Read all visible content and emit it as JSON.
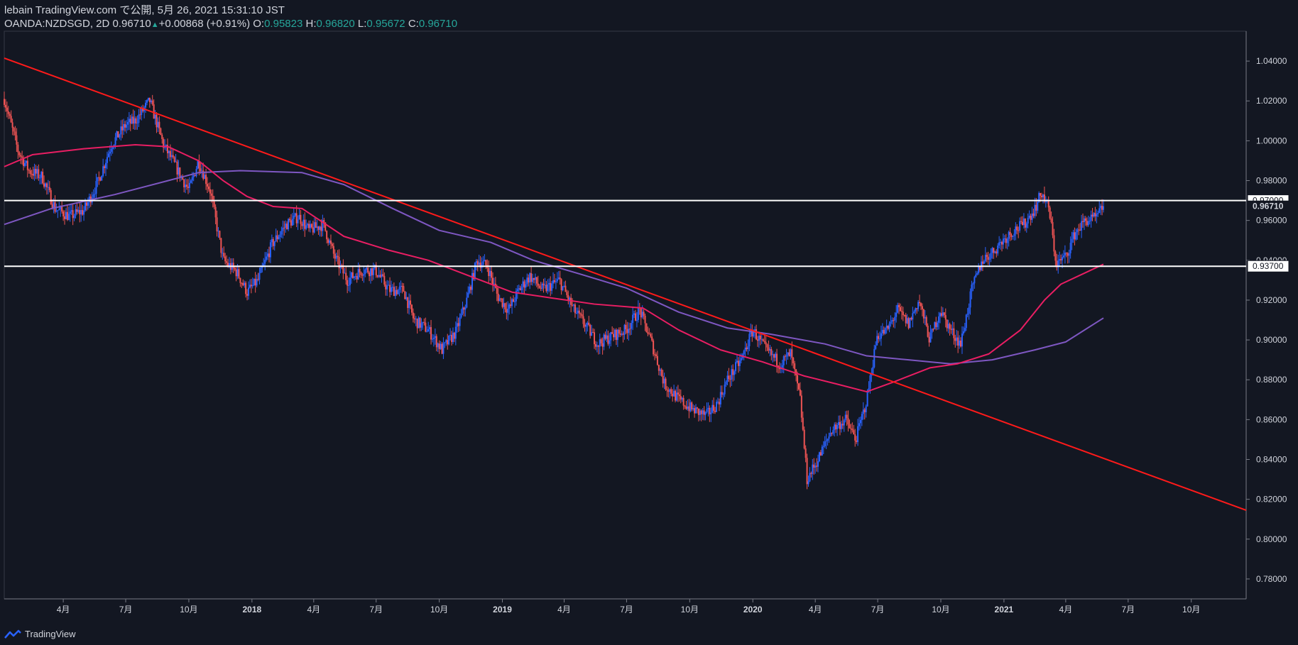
{
  "header": {
    "line1": "lebain TradingView.com で公開, 5月 26, 2021 15:31:10 JST",
    "symbol": "OANDA:NZDSGD, 2D 0.96710",
    "change": "+0.00868 (+0.91%)",
    "o_label": "O:",
    "o": "0.95823",
    "h_label": "H:",
    "h": "0.96820",
    "l_label": "L:",
    "l": "0.95672",
    "c_label": "C:",
    "c": "0.96710"
  },
  "footer": {
    "brand": "TradingView"
  },
  "colors": {
    "background": "#131722",
    "up": "#2962ff",
    "down": "#f05454",
    "ma_fast": "#e91e63",
    "ma_slow": "#7e57c2",
    "trendline": "#ff1a1a",
    "level_line": "#ffffff"
  },
  "chart_data": {
    "type": "candlestick",
    "symbol": "OANDA:NZDSGD",
    "interval": "2D",
    "ylim": [
      0.77,
      1.055
    ],
    "y_ticks": [
      "1.04000",
      "1.02000",
      "1.00000",
      "0.98000",
      "0.96000",
      "0.94000",
      "0.92000",
      "0.90000",
      "0.88000",
      "0.86000",
      "0.84000",
      "0.82000",
      "0.80000",
      "0.78000"
    ],
    "x_ticks": [
      "4月",
      "7月",
      "10月",
      "2018",
      "4月",
      "7月",
      "10月",
      "2019",
      "4月",
      "7月",
      "10月",
      "2020",
      "4月",
      "7月",
      "10月",
      "2021",
      "4月",
      "7月",
      "10月"
    ],
    "x_tick_dates": [
      "2017-04-01",
      "2017-07-01",
      "2017-10-01",
      "2018-01-01",
      "2018-04-01",
      "2018-07-01",
      "2018-10-01",
      "2019-01-01",
      "2019-04-01",
      "2019-07-01",
      "2019-10-01",
      "2020-01-01",
      "2020-04-01",
      "2020-07-01",
      "2020-10-01",
      "2021-01-01",
      "2021-04-01",
      "2021-07-01",
      "2021-10-01"
    ],
    "xlim": [
      "2017-01-05",
      "2021-12-20"
    ],
    "horizontal_levels": [
      {
        "value": 0.97,
        "label": "0.97000"
      },
      {
        "value": 0.937,
        "label": "0.93700"
      }
    ],
    "last_price_label": "0.96710",
    "trendline": {
      "start": [
        "2017-01-05",
        1.0415
      ],
      "end": [
        "2021-12-20",
        0.8145
      ]
    },
    "price_path": [
      [
        "2017-01-05",
        1.021
      ],
      [
        "2017-01-25",
        0.995
      ],
      [
        "2017-02-10",
        0.985
      ],
      [
        "2017-03-01",
        0.982
      ],
      [
        "2017-03-20",
        0.966
      ],
      [
        "2017-04-10",
        0.962
      ],
      [
        "2017-05-01",
        0.965
      ],
      [
        "2017-05-20",
        0.978
      ],
      [
        "2017-06-10",
        0.998
      ],
      [
        "2017-07-01",
        1.008
      ],
      [
        "2017-07-15",
        1.01
      ],
      [
        "2017-08-05",
        1.02
      ],
      [
        "2017-08-25",
        0.998
      ],
      [
        "2017-09-15",
        0.985
      ],
      [
        "2017-10-01",
        0.975
      ],
      [
        "2017-10-15",
        0.99
      ],
      [
        "2017-11-01",
        0.975
      ],
      [
        "2017-11-20",
        0.94
      ],
      [
        "2017-12-10",
        0.934
      ],
      [
        "2017-12-25",
        0.924
      ],
      [
        "2018-01-10",
        0.93
      ],
      [
        "2018-01-30",
        0.948
      ],
      [
        "2018-02-20",
        0.958
      ],
      [
        "2018-03-10",
        0.962
      ],
      [
        "2018-03-25",
        0.955
      ],
      [
        "2018-04-15",
        0.958
      ],
      [
        "2018-05-01",
        0.942
      ],
      [
        "2018-05-20",
        0.93
      ],
      [
        "2018-06-10",
        0.935
      ],
      [
        "2018-06-30",
        0.935
      ],
      [
        "2018-07-20",
        0.925
      ],
      [
        "2018-08-10",
        0.925
      ],
      [
        "2018-08-25",
        0.91
      ],
      [
        "2018-09-15",
        0.905
      ],
      [
        "2018-10-05",
        0.895
      ],
      [
        "2018-10-25",
        0.904
      ],
      [
        "2018-11-10",
        0.92
      ],
      [
        "2018-11-25",
        0.94
      ],
      [
        "2018-12-10",
        0.937
      ],
      [
        "2018-12-25",
        0.922
      ],
      [
        "2019-01-10",
        0.915
      ],
      [
        "2019-01-25",
        0.925
      ],
      [
        "2019-02-10",
        0.932
      ],
      [
        "2019-03-01",
        0.925
      ],
      [
        "2019-03-25",
        0.93
      ],
      [
        "2019-04-15",
        0.915
      ],
      [
        "2019-05-01",
        0.908
      ],
      [
        "2019-05-20",
        0.898
      ],
      [
        "2019-06-10",
        0.902
      ],
      [
        "2019-06-30",
        0.905
      ],
      [
        "2019-07-20",
        0.915
      ],
      [
        "2019-08-05",
        0.9
      ],
      [
        "2019-08-25",
        0.878
      ],
      [
        "2019-09-15",
        0.87
      ],
      [
        "2019-10-05",
        0.865
      ],
      [
        "2019-10-25",
        0.862
      ],
      [
        "2019-11-10",
        0.868
      ],
      [
        "2019-11-25",
        0.88
      ],
      [
        "2019-12-15",
        0.89
      ],
      [
        "2020-01-01",
        0.905
      ],
      [
        "2020-01-20",
        0.895
      ],
      [
        "2020-02-10",
        0.888
      ],
      [
        "2020-02-25",
        0.893
      ],
      [
        "2020-03-10",
        0.87
      ],
      [
        "2020-03-20",
        0.83
      ],
      [
        "2020-04-05",
        0.84
      ],
      [
        "2020-04-25",
        0.855
      ],
      [
        "2020-05-15",
        0.86
      ],
      [
        "2020-05-30",
        0.85
      ],
      [
        "2020-06-15",
        0.87
      ],
      [
        "2020-06-30",
        0.902
      ],
      [
        "2020-07-15",
        0.905
      ],
      [
        "2020-07-30",
        0.915
      ],
      [
        "2020-08-15",
        0.908
      ],
      [
        "2020-08-30",
        0.92
      ],
      [
        "2020-09-15",
        0.9
      ],
      [
        "2020-09-30",
        0.915
      ],
      [
        "2020-10-15",
        0.905
      ],
      [
        "2020-10-30",
        0.898
      ],
      [
        "2020-11-15",
        0.925
      ],
      [
        "2020-11-30",
        0.94
      ],
      [
        "2020-12-15",
        0.944
      ],
      [
        "2020-12-30",
        0.95
      ],
      [
        "2021-01-15",
        0.955
      ],
      [
        "2021-01-30",
        0.958
      ],
      [
        "2021-02-15",
        0.966
      ],
      [
        "2021-02-25",
        0.974
      ],
      [
        "2021-03-08",
        0.965
      ],
      [
        "2021-03-18",
        0.938
      ],
      [
        "2021-04-01",
        0.942
      ],
      [
        "2021-04-15",
        0.954
      ],
      [
        "2021-04-30",
        0.96
      ],
      [
        "2021-05-15",
        0.961
      ],
      [
        "2021-05-26",
        0.9671
      ]
    ],
    "ma_fast_path": [
      [
        "2017-01-05",
        0.987
      ],
      [
        "2017-02-15",
        0.993
      ],
      [
        "2017-05-01",
        0.996
      ],
      [
        "2017-07-15",
        0.998
      ],
      [
        "2017-09-01",
        0.997
      ],
      [
        "2017-10-15",
        0.99
      ],
      [
        "2017-11-20",
        0.98
      ],
      [
        "2017-12-25",
        0.972
      ],
      [
        "2018-02-01",
        0.967
      ],
      [
        "2018-03-15",
        0.966
      ],
      [
        "2018-05-15",
        0.952
      ],
      [
        "2018-07-20",
        0.945
      ],
      [
        "2018-09-15",
        0.94
      ],
      [
        "2018-11-15",
        0.932
      ],
      [
        "2019-01-15",
        0.924
      ],
      [
        "2019-03-15",
        0.921
      ],
      [
        "2019-05-15",
        0.918
      ],
      [
        "2019-07-25",
        0.916
      ],
      [
        "2019-09-15",
        0.905
      ],
      [
        "2019-11-15",
        0.895
      ],
      [
        "2020-01-15",
        0.889
      ],
      [
        "2020-03-15",
        0.882
      ],
      [
        "2020-05-01",
        0.878
      ],
      [
        "2020-06-15",
        0.874
      ],
      [
        "2020-07-25",
        0.879
      ],
      [
        "2020-09-15",
        0.886
      ],
      [
        "2020-10-25",
        0.888
      ],
      [
        "2020-12-10",
        0.893
      ],
      [
        "2021-01-25",
        0.905
      ],
      [
        "2021-03-01",
        0.92
      ],
      [
        "2021-03-25",
        0.928
      ],
      [
        "2021-05-26",
        0.938
      ]
    ],
    "ma_slow_path": [
      [
        "2017-01-05",
        0.958
      ],
      [
        "2017-03-15",
        0.966
      ],
      [
        "2017-06-15",
        0.973
      ],
      [
        "2017-09-01",
        0.98
      ],
      [
        "2017-10-15",
        0.984
      ],
      [
        "2017-12-15",
        0.985
      ],
      [
        "2018-03-15",
        0.984
      ],
      [
        "2018-05-15",
        0.978
      ],
      [
        "2018-07-25",
        0.966
      ],
      [
        "2018-10-01",
        0.955
      ],
      [
        "2018-12-15",
        0.949
      ],
      [
        "2019-02-15",
        0.94
      ],
      [
        "2019-04-25",
        0.933
      ],
      [
        "2019-07-01",
        0.926
      ],
      [
        "2019-09-15",
        0.914
      ],
      [
        "2019-11-25",
        0.906
      ],
      [
        "2020-01-25",
        0.903
      ],
      [
        "2020-04-15",
        0.898
      ],
      [
        "2020-06-15",
        0.892
      ],
      [
        "2020-08-15",
        0.89
      ],
      [
        "2020-10-15",
        0.888
      ],
      [
        "2020-12-15",
        0.89
      ],
      [
        "2021-02-15",
        0.895
      ],
      [
        "2021-04-01",
        0.899
      ],
      [
        "2021-05-26",
        0.911
      ]
    ]
  }
}
